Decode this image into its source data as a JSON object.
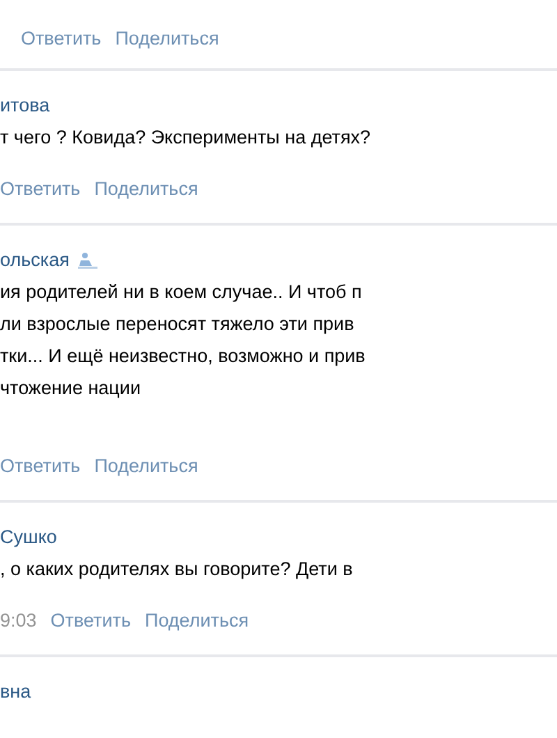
{
  "comments": [
    {
      "actions": [
        "Ответить",
        "Поделиться"
      ]
    },
    {
      "author": "итова",
      "text_lines": [
        "т чего ? Ковида? Эксперименты на детях?"
      ],
      "actions": [
        "Ответить",
        "Поделиться"
      ]
    },
    {
      "author": "ольская",
      "author_badge": true,
      "text_lines": [
        "ия родителей ни в коем случае.. И чтоб п",
        "ли взрослые переносят тяжело эти прив",
        "тки... И ещё неизвестно, возможно и прив",
        "чтожение нации"
      ],
      "actions": [
        "Ответить",
        "Поделиться"
      ]
    },
    {
      "author": "Сушко",
      "text_lines": [
        ", о каких родителях вы говорите? Дети в"
      ],
      "time": "9:03",
      "actions": [
        "Ответить",
        "Поделиться"
      ]
    },
    {
      "author": "вна"
    }
  ]
}
